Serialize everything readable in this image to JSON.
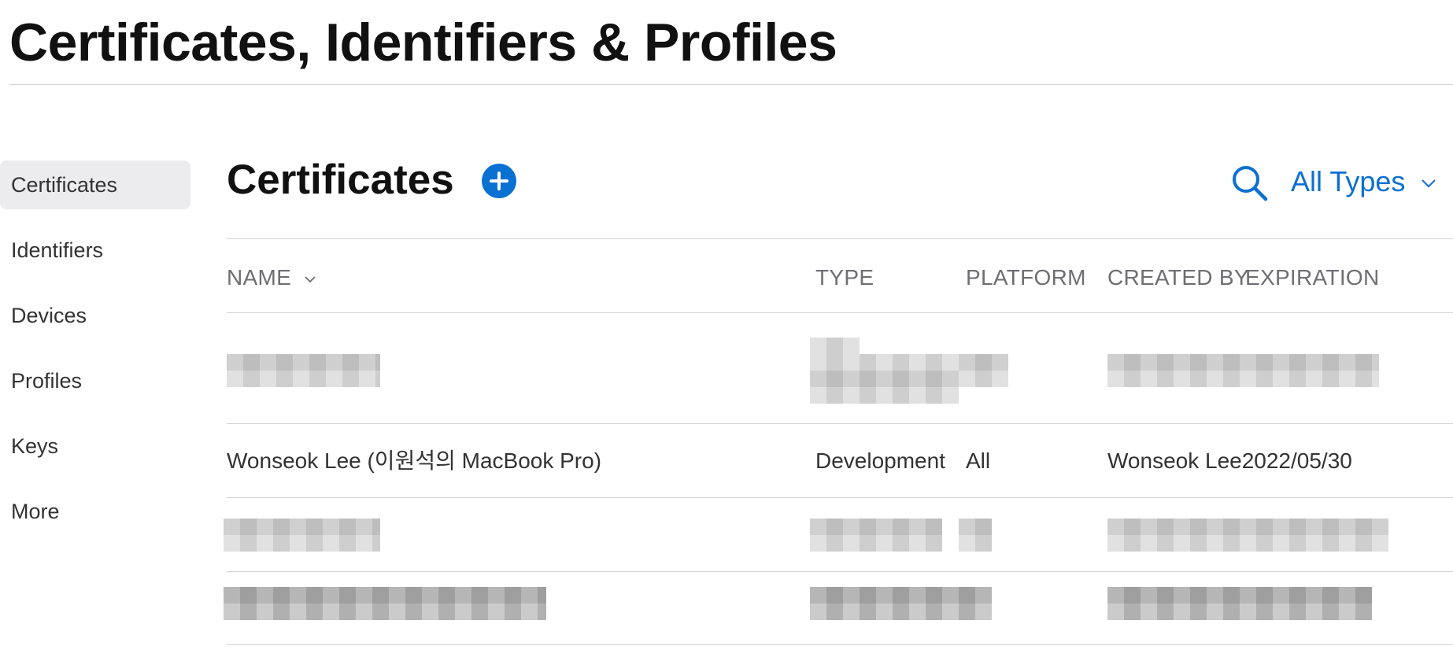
{
  "page": {
    "title": "Certificates, Identifiers & Profiles"
  },
  "sidebar": {
    "items": [
      {
        "label": "Certificates",
        "active": true
      },
      {
        "label": "Identifiers"
      },
      {
        "label": "Devices"
      },
      {
        "label": "Profiles"
      },
      {
        "label": "Keys"
      },
      {
        "label": "More"
      }
    ]
  },
  "section": {
    "title": "Certificates",
    "add_icon": "plus-circle-icon",
    "search_icon": "search-icon",
    "filter_label": "All Types"
  },
  "table": {
    "columns": {
      "name": "NAME",
      "type": "TYPE",
      "platform": "PLATFORM",
      "created_by": "CREATED BY",
      "expiration": "EXPIRATION"
    },
    "rows": [
      {
        "redacted": true
      },
      {
        "name": "Wonseok Lee (이원석의 MacBook Pro)",
        "type": "Development",
        "platform": "All",
        "created_by": "Wonseok Lee",
        "expiration": "2022/05/30"
      },
      {
        "redacted": true
      },
      {
        "redacted": true
      }
    ]
  },
  "colors": {
    "accent": "#0a70d2",
    "title": "#111111",
    "muted": "#6e6e73"
  }
}
